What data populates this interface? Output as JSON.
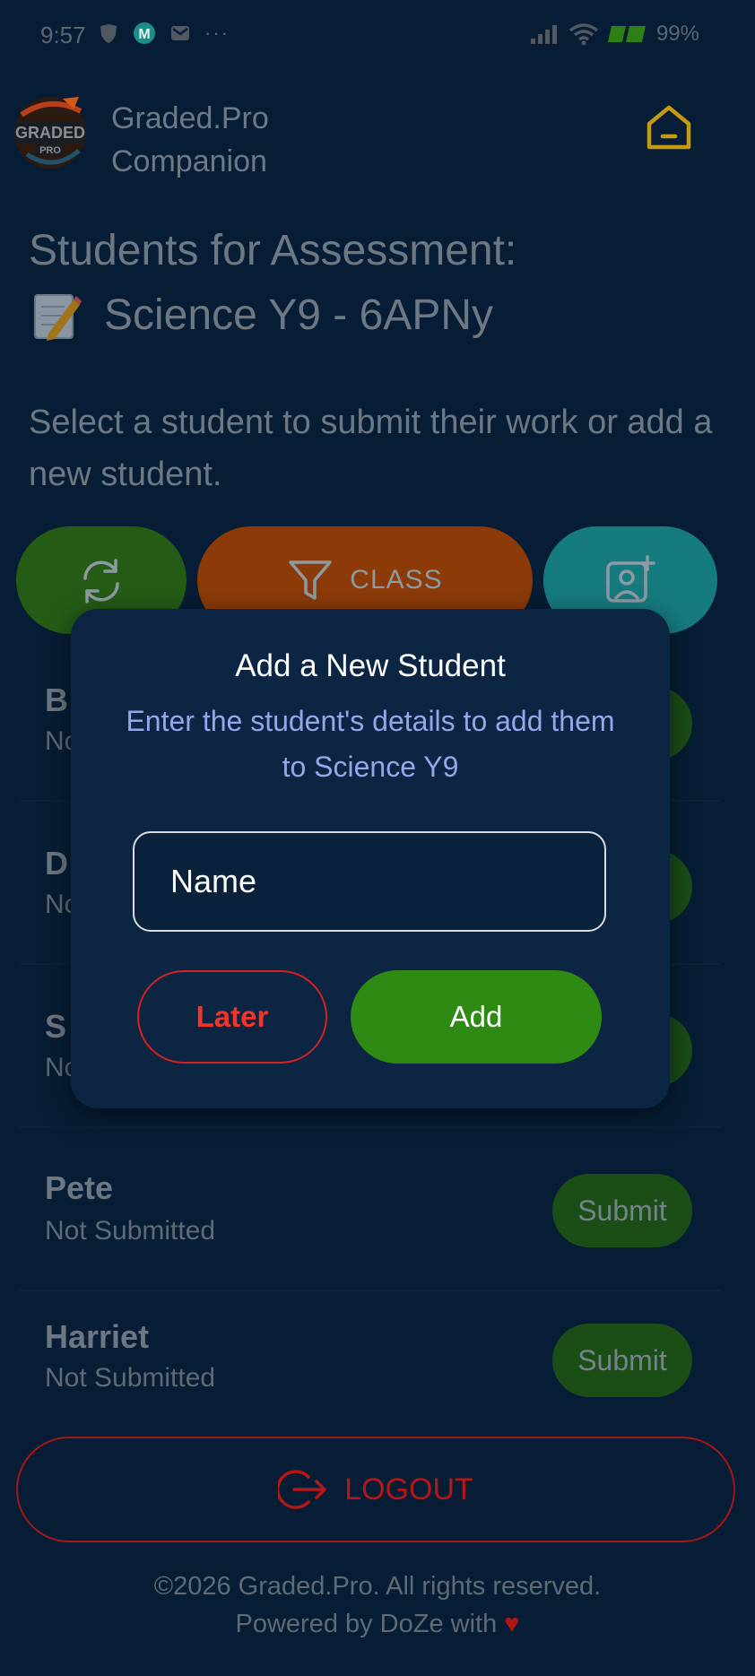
{
  "status_bar": {
    "time": "9:57",
    "battery": "99%",
    "more": "···"
  },
  "header": {
    "app_name": "Graded.Pro",
    "app_sub": "Companion",
    "logo_top": "GRADED",
    "logo_bottom": "PRO"
  },
  "page": {
    "title_line1": "Students for Assessment:",
    "title_line2": "Science Y9 - 6APNy",
    "subtitle": "Select a student to submit their work or add a new student."
  },
  "actions": {
    "class_label": "CLASS"
  },
  "students": [
    {
      "name": "B",
      "status": "No"
    },
    {
      "name": "D",
      "status": "No"
    },
    {
      "name": "S",
      "status": "No"
    },
    {
      "name": "Pete",
      "status": "Not Submitted"
    },
    {
      "name": "Harriet",
      "status": "Not Submitted"
    }
  ],
  "submit_label": "Submit",
  "logout_label": "LOGOUT",
  "footer": {
    "copyright": "©2026 Graded.Pro. All rights reserved.",
    "powered": "Powered by DoZe with",
    "heart": "♥"
  },
  "modal": {
    "title": "Add a New Student",
    "description": "Enter the student's details to add them to Science Y9",
    "name_placeholder": "Name",
    "later_label": "Later",
    "add_label": "Add"
  },
  "colors": {
    "background": "#071d35",
    "modal": "#0b2542",
    "green": "#2e8a12",
    "orange": "#d35400",
    "teal": "#17aaaf",
    "red": "#e12424",
    "home_icon": "#f2c014"
  }
}
